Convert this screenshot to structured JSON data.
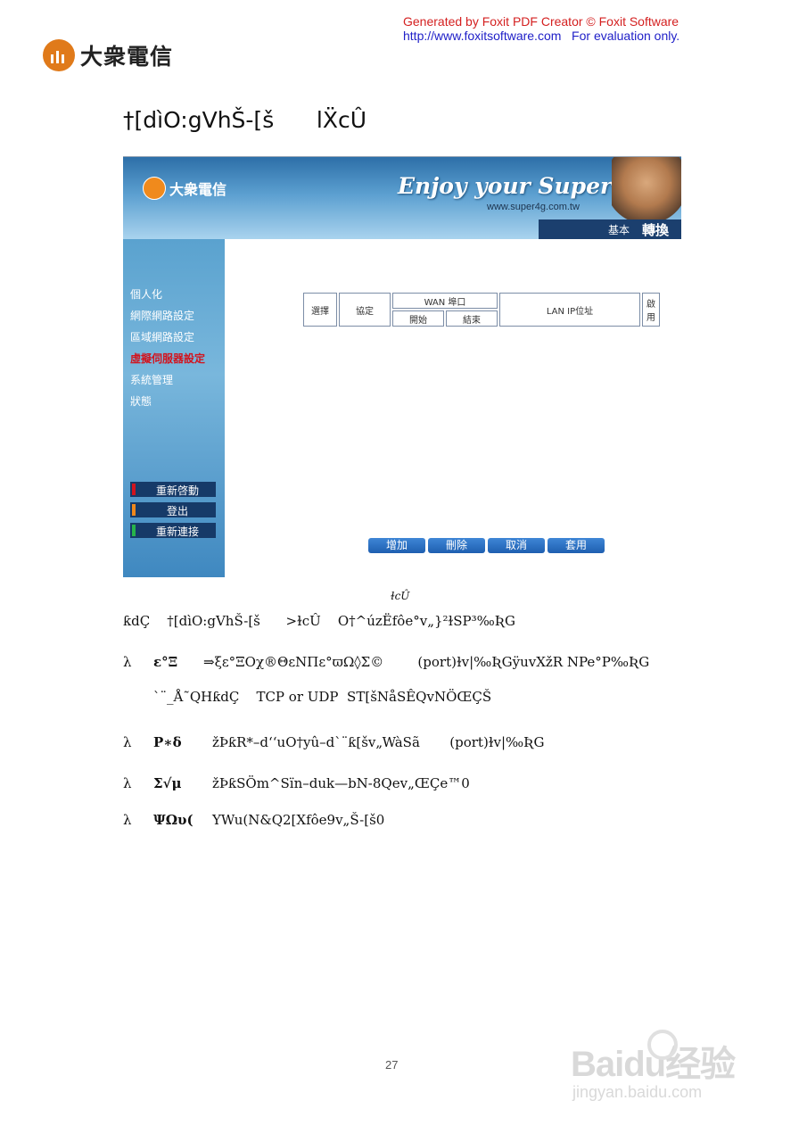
{
  "foxit": {
    "line1": "Generated by Foxit PDF Creator © Foxit Software",
    "line2": "http://www.foxitsoftware.com   For evaluation only."
  },
  "brand": {
    "name": "大衆電信"
  },
  "heading": "†[dìO:gVhŠ-[š      lẌcÛ",
  "screenshot": {
    "logo": "大衆電信",
    "slogan": "Enjoy your Super 4G",
    "url": "www.super4g.com.tw",
    "tabs": [
      "基本",
      "轉換"
    ],
    "sidebar": [
      "個人化",
      "網際網路設定",
      "區域網路設定",
      "虛擬伺服器設定",
      "系統管理",
      "狀態"
    ],
    "side_buttons": [
      {
        "label": "重新啓動",
        "color": "#d2141e"
      },
      {
        "label": "登出",
        "color": "#f0881c"
      },
      {
        "label": "重新連接",
        "color": "#27b34a"
      }
    ],
    "table": {
      "select": "選擇",
      "protocol": "協定",
      "wan_port": "WAN 埠口",
      "start": "開始",
      "end": "結束",
      "lan_ip": "LAN IP位址",
      "enable": "啟用"
    },
    "buttons": [
      "增加",
      "刪除",
      "取消",
      "套用"
    ]
  },
  "caption": "ɫcÛ",
  "paragraphs": {
    "p1": "ƙdÇ    †[dìO:gVhŠ-[š      >ɫcÛ    O†^úzËfôe°v„}²ɫSP³‰ƦG",
    "b1_term": "ε°Ξ",
    "b1_text": "⇒ξε°ΞΟχ®ΘεΝΠε°ϖΩ◊Σ©        (port)ɫv|‰ƦGÿuvXžR NPe°P‰ƦG",
    "b1_cont": "`¨_Å˜QHƙdÇ    TCP or UDP  ST[šNåSÊQvNÖŒÇŠ",
    "b2_term": "Ρ∗δ",
    "b2_text": "žÞƙR*–d‘‘uO†yû–d`¨ƙ[šv„WàSã       (port)ɫv|‰ƦG",
    "b3_term": "Σ√μ",
    "b3_text": "žÞƙSÖm^Sïn–duk—bN-8Qev„ŒÇe™0",
    "b4_term": "ΨΩυ(",
    "b4_text": "YWu(N&Q2[Xfôe9v„Š-[š0",
    "bullet": "λ"
  },
  "page_number": "27",
  "watermark": {
    "logo": "Baidu经验",
    "url": "jingyan.baidu.com"
  }
}
